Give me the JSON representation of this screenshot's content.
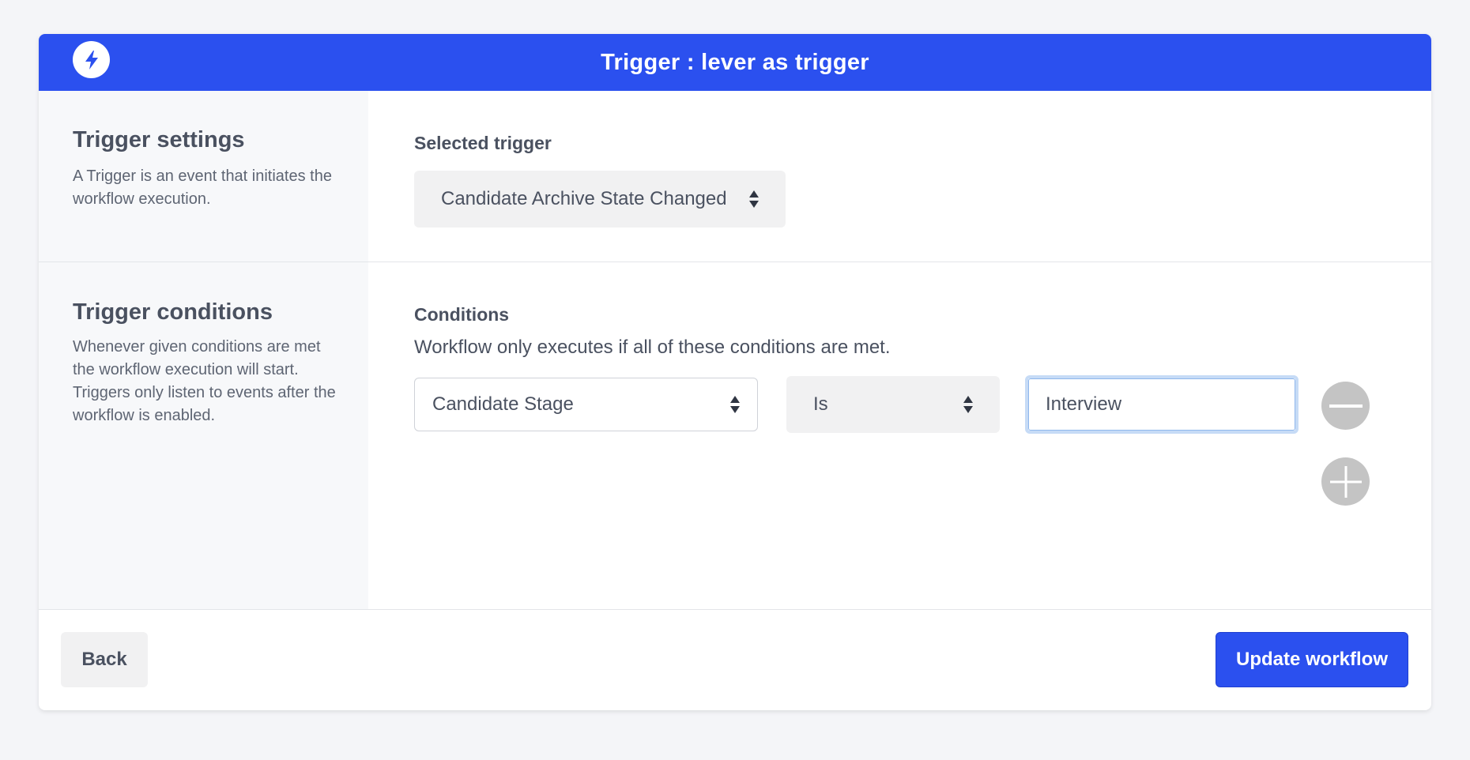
{
  "header": {
    "title": "Trigger : lever as trigger",
    "icon": "bolt-icon",
    "color": "#2b50ef"
  },
  "trigger_settings": {
    "title": "Trigger settings",
    "description": "A Trigger is an event that initiates the workflow execution.",
    "field_label": "Selected trigger",
    "selected_trigger": "Candidate Archive State Changed"
  },
  "trigger_conditions": {
    "title": "Trigger conditions",
    "description": "Whenever given conditions are met the workflow execution will start. Triggers only listen to events after the workflow is enabled.",
    "field_label": "Conditions",
    "help_text": "Workflow only executes if all of these conditions are met.",
    "conditions": [
      {
        "field": "Candidate Stage",
        "operator": "Is",
        "value": "Interview"
      }
    ]
  },
  "footer": {
    "back_label": "Back",
    "update_label": "Update workflow"
  }
}
